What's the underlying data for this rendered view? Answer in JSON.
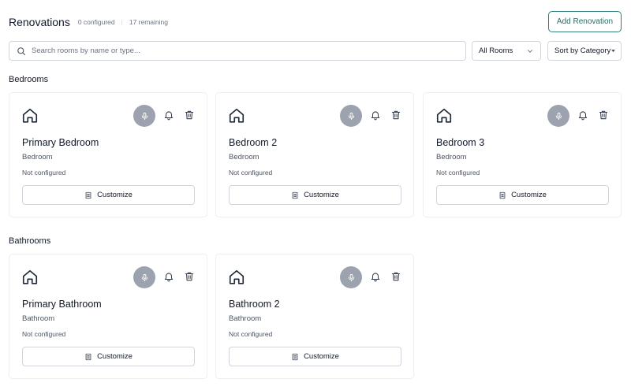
{
  "header": {
    "title": "Renovations",
    "configured": "0 configured",
    "separator": "|",
    "remaining": "17 remaining",
    "add_button": "Add Renovation"
  },
  "search": {
    "placeholder": "Search rooms by name or type..."
  },
  "filters": {
    "rooms": "All Rooms",
    "sort": "Sort by Category"
  },
  "sections": [
    {
      "title": "Bedrooms",
      "cards": [
        {
          "name": "Primary Bedroom",
          "type": "Bedroom",
          "status": "Not configured",
          "button": "Customize"
        },
        {
          "name": "Bedroom 2",
          "type": "Bedroom",
          "status": "Not configured",
          "button": "Customize"
        },
        {
          "name": "Bedroom 3",
          "type": "Bedroom",
          "status": "Not configured",
          "button": "Customize"
        }
      ]
    },
    {
      "title": "Bathrooms",
      "cards": [
        {
          "name": "Primary Bathroom",
          "type": "Bathroom",
          "status": "Not configured",
          "button": "Customize"
        },
        {
          "name": "Bathroom 2",
          "type": "Bathroom",
          "status": "Not configured",
          "button": "Customize"
        }
      ]
    }
  ],
  "icons": [
    "search-icon",
    "chevron-down-icon",
    "house-icon",
    "microphone-icon",
    "bell-icon",
    "trash-icon",
    "document-icon"
  ],
  "colors": {
    "accent": "#2f7f7a",
    "mic_bg": "#9ca3af",
    "border": "#d1d5db"
  }
}
